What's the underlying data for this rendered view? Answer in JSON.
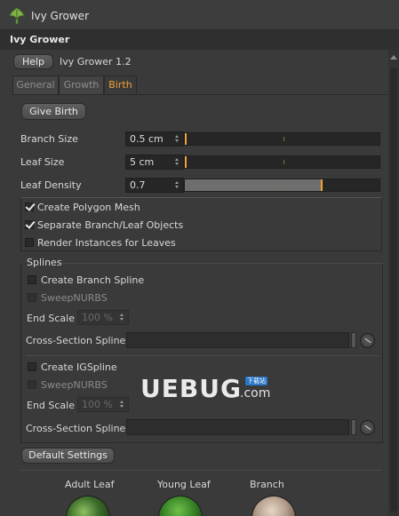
{
  "window": {
    "title": "Ivy Grower"
  },
  "header": {
    "title": "Ivy Grower"
  },
  "toolbar": {
    "help_label": "Help",
    "version": "Ivy Grower 1.2"
  },
  "tabs": [
    {
      "label": "General",
      "active": false
    },
    {
      "label": "Growth",
      "active": false
    },
    {
      "label": "Birth",
      "active": true
    }
  ],
  "birth": {
    "give_birth_label": "Give Birth",
    "branch_size": {
      "label": "Branch Size",
      "value": "0.5 cm",
      "slider_fraction": 0.0
    },
    "leaf_size": {
      "label": "Leaf Size",
      "value": "5 cm",
      "slider_fraction": 0.0
    },
    "leaf_density": {
      "label": "Leaf Density",
      "value": "0.7",
      "slider_fraction": 0.7
    },
    "options": [
      {
        "label": "Create Polygon Mesh",
        "checked": true
      },
      {
        "label": "Separate Branch/Leaf Objects",
        "checked": true
      },
      {
        "label": "Render Instances for Leaves",
        "checked": false
      }
    ]
  },
  "splines": {
    "title": "Splines",
    "create_branch_spline": {
      "label": "Create Branch Spline",
      "checked": false
    },
    "sweep_nurbs_1": {
      "label": "SweepNURBS",
      "checked": false,
      "enabled": false
    },
    "end_scale_1": {
      "label": "End Scale",
      "value": "100 %"
    },
    "cross_section_1": {
      "label": "Cross-Section Spline",
      "value": ""
    },
    "create_igspline": {
      "label": "Create IGSpline",
      "checked": false
    },
    "sweep_nurbs_2": {
      "label": "SweepNURBS",
      "checked": false,
      "enabled": false
    },
    "end_scale_2": {
      "label": "End Scale",
      "value": "100 %"
    },
    "cross_section_2": {
      "label": "Cross-Section Spline",
      "value": ""
    }
  },
  "default_settings_label": "Default Settings",
  "materials": [
    {
      "label": "Adult Leaf"
    },
    {
      "label": "Young Leaf"
    },
    {
      "label": "Branch"
    }
  ],
  "watermark": {
    "text": "UEBUG",
    "suffix": ".com",
    "tag": "下载站"
  },
  "colors": {
    "accent": "#f0a23a",
    "background": "#3a3a3a",
    "field": "#262626"
  }
}
